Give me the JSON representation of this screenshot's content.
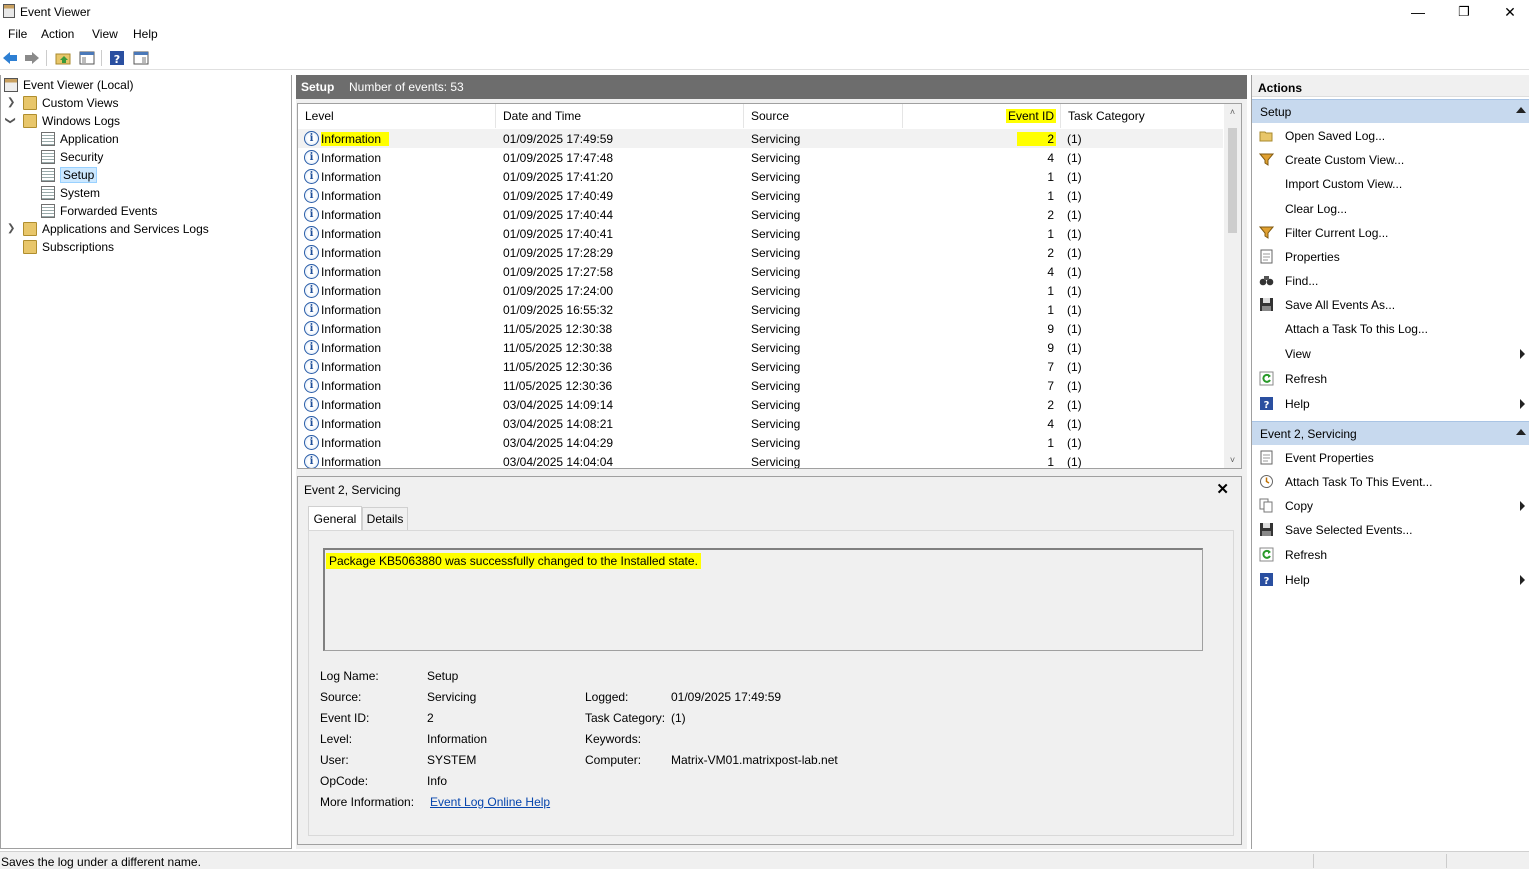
{
  "window": {
    "title": "Event Viewer",
    "minimize": "—",
    "maximize": "❐",
    "close": "✕"
  },
  "menu": [
    "File",
    "Action",
    "View",
    "Help"
  ],
  "tree": {
    "root": "Event Viewer (Local)",
    "custom_views": "Custom Views",
    "windows_logs": "Windows Logs",
    "application": "Application",
    "security": "Security",
    "setup": "Setup",
    "system": "System",
    "forwarded": "Forwarded Events",
    "app_services": "Applications and Services Logs",
    "subscriptions": "Subscriptions"
  },
  "log_header": {
    "name": "Setup",
    "count": "Number of events: 53"
  },
  "columns": [
    "Level",
    "Date and Time",
    "Source",
    "Event ID",
    "Task Category"
  ],
  "events": [
    {
      "level": "Information",
      "date": "01/09/2025 17:49:59",
      "source": "Servicing",
      "id": "2",
      "task": "(1)"
    },
    {
      "level": "Information",
      "date": "01/09/2025 17:47:48",
      "source": "Servicing",
      "id": "4",
      "task": "(1)"
    },
    {
      "level": "Information",
      "date": "01/09/2025 17:41:20",
      "source": "Servicing",
      "id": "1",
      "task": "(1)"
    },
    {
      "level": "Information",
      "date": "01/09/2025 17:40:49",
      "source": "Servicing",
      "id": "1",
      "task": "(1)"
    },
    {
      "level": "Information",
      "date": "01/09/2025 17:40:44",
      "source": "Servicing",
      "id": "2",
      "task": "(1)"
    },
    {
      "level": "Information",
      "date": "01/09/2025 17:40:41",
      "source": "Servicing",
      "id": "1",
      "task": "(1)"
    },
    {
      "level": "Information",
      "date": "01/09/2025 17:28:29",
      "source": "Servicing",
      "id": "2",
      "task": "(1)"
    },
    {
      "level": "Information",
      "date": "01/09/2025 17:27:58",
      "source": "Servicing",
      "id": "4",
      "task": "(1)"
    },
    {
      "level": "Information",
      "date": "01/09/2025 17:24:00",
      "source": "Servicing",
      "id": "1",
      "task": "(1)"
    },
    {
      "level": "Information",
      "date": "01/09/2025 16:55:32",
      "source": "Servicing",
      "id": "1",
      "task": "(1)"
    },
    {
      "level": "Information",
      "date": "11/05/2025 12:30:38",
      "source": "Servicing",
      "id": "9",
      "task": "(1)"
    },
    {
      "level": "Information",
      "date": "11/05/2025 12:30:38",
      "source": "Servicing",
      "id": "9",
      "task": "(1)"
    },
    {
      "level": "Information",
      "date": "11/05/2025 12:30:36",
      "source": "Servicing",
      "id": "7",
      "task": "(1)"
    },
    {
      "level": "Information",
      "date": "11/05/2025 12:30:36",
      "source": "Servicing",
      "id": "7",
      "task": "(1)"
    },
    {
      "level": "Information",
      "date": "03/04/2025 14:09:14",
      "source": "Servicing",
      "id": "2",
      "task": "(1)"
    },
    {
      "level": "Information",
      "date": "03/04/2025 14:08:21",
      "source": "Servicing",
      "id": "4",
      "task": "(1)"
    },
    {
      "level": "Information",
      "date": "03/04/2025 14:04:29",
      "source": "Servicing",
      "id": "1",
      "task": "(1)"
    },
    {
      "level": "Information",
      "date": "03/04/2025 14:04:04",
      "source": "Servicing",
      "id": "1",
      "task": "(1)"
    }
  ],
  "detail": {
    "title": "Event 2, Servicing",
    "tabs": [
      "General",
      "Details"
    ],
    "message": "Package KB5063880 was successfully changed to the Installed state.",
    "labels": {
      "log_name": "Log Name:",
      "source": "Source:",
      "event_id": "Event ID:",
      "level": "Level:",
      "user": "User:",
      "opcode": "OpCode:",
      "more_info": "More Information:",
      "logged": "Logged:",
      "task_category": "Task Category:",
      "keywords": "Keywords:",
      "computer": "Computer:"
    },
    "values": {
      "log_name": "Setup",
      "source": "Servicing",
      "event_id": "2",
      "level": "Information",
      "user": "SYSTEM",
      "opcode": "Info",
      "more_info": "Event Log Online Help",
      "logged": "01/09/2025 17:49:59",
      "task_category": "(1)",
      "keywords": "",
      "computer": "Matrix-VM01.matrixpost-lab.net"
    }
  },
  "actions": {
    "title": "Actions",
    "setup_section": "Setup",
    "setup_items": [
      "Open Saved Log...",
      "Create Custom View...",
      "Import Custom View...",
      "Clear Log...",
      "Filter Current Log...",
      "Properties",
      "Find...",
      "Save All Events As...",
      "Attach a Task To this Log...",
      "View",
      "Refresh",
      "Help"
    ],
    "event_section": "Event 2, Servicing",
    "event_items": [
      "Event Properties",
      "Attach Task To This Event...",
      "Copy",
      "Save Selected Events...",
      "Refresh",
      "Help"
    ]
  },
  "status": "Saves the log under a different name.",
  "colors": {
    "highlight": "#ffff00",
    "selection": "#cce8ff",
    "section": "#c7d9ee",
    "header": "#6d6d6d"
  }
}
